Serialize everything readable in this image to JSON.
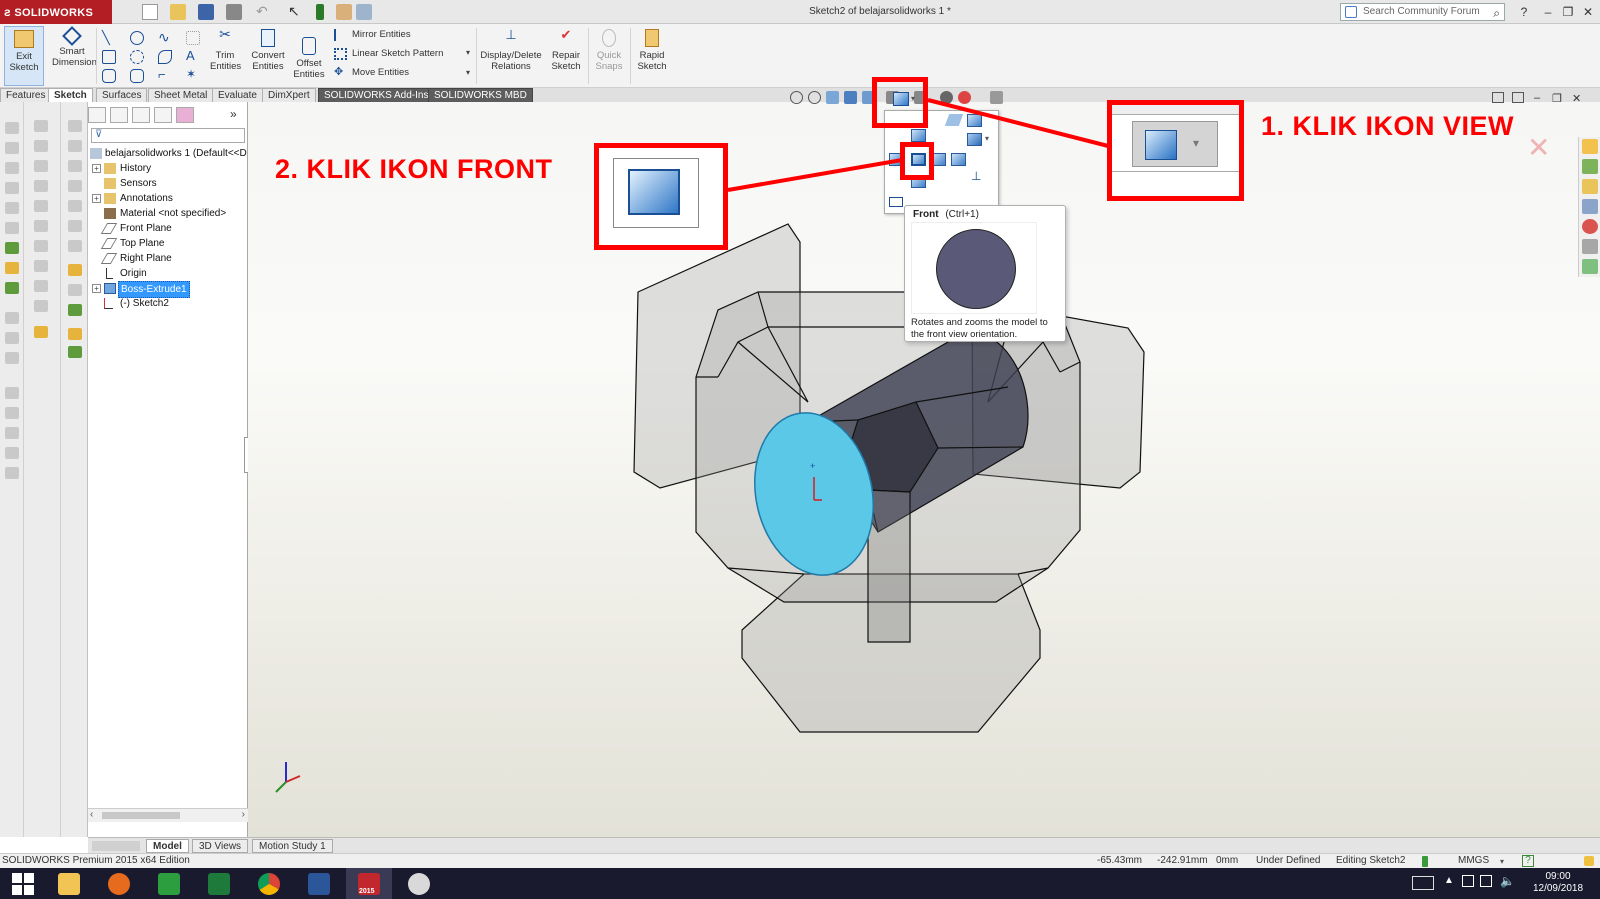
{
  "app": {
    "brand": "SOLIDWORKS",
    "document_title": "Sketch2 of belajarsolidworks 1 *",
    "search_placeholder": "Search Community Forum"
  },
  "ribbon": {
    "exit_sketch": "Exit\nSketch",
    "smart_dimension": "Smart\nDimension",
    "trim_entities": "Trim\nEntities",
    "convert_entities": "Convert\nEntities",
    "offset_entities": "Offset\nEntities",
    "mirror_entities": "Mirror Entities",
    "linear_sketch_pattern": "Linear Sketch Pattern",
    "move_entities": "Move Entities",
    "display_delete_relations": "Display/Delete\nRelations",
    "repair_sketch": "Repair\nSketch",
    "quick_snaps": "Quick\nSnaps",
    "rapid_sketch": "Rapid\nSketch"
  },
  "command_tabs": [
    "Features",
    "Sketch",
    "Surfaces",
    "Sheet Metal",
    "Evaluate",
    "DimXpert",
    "SOLIDWORKS Add-Ins",
    "SOLIDWORKS MBD"
  ],
  "active_tab": "Sketch",
  "feature_tree": {
    "root": "belajarsolidworks 1  (Default<<D",
    "items": [
      {
        "label": "History",
        "icon": "history-icon"
      },
      {
        "label": "Sensors",
        "icon": "sensors-icon"
      },
      {
        "label": "Annotations",
        "icon": "annotations-icon"
      },
      {
        "label": "Material <not specified>",
        "icon": "material-icon"
      },
      {
        "label": "Front Plane",
        "icon": "plane-icon"
      },
      {
        "label": "Top Plane",
        "icon": "plane-icon"
      },
      {
        "label": "Right Plane",
        "icon": "plane-icon"
      },
      {
        "label": "Origin",
        "icon": "origin-icon"
      },
      {
        "label": "Boss-Extrude1",
        "icon": "extrude-icon",
        "selected": true
      },
      {
        "label": "(-) Sketch2",
        "icon": "sketch-icon"
      }
    ]
  },
  "callouts": {
    "step1": "1. KLIK IKON VIEW",
    "step2": "2. KLIK IKON FRONT",
    "color": "#ff0000"
  },
  "tooltip": {
    "title": "Front",
    "shortcut": "(Ctrl+1)",
    "description": "Rotates and zooms the model to the front view orientation."
  },
  "bottom_tabs": [
    "Model",
    "3D Views",
    "Motion Study 1"
  ],
  "active_bottom_tab": "Model",
  "status": {
    "edition": "SOLIDWORKS Premium 2015 x64 Edition",
    "x": "-65.43mm",
    "y": "-242.91mm",
    "z": "0mm",
    "sketch_state": "Under Defined",
    "editing": "Editing Sketch2",
    "units": "MMGS",
    "help": "?"
  },
  "taskbar": {
    "time": "09:00",
    "date": "12/09/2018",
    "sw_badge": "2015"
  },
  "colors": {
    "accent_red": "#ff0000",
    "sketch_face": "#5bc8e8",
    "brand_red": "#b21e23"
  }
}
